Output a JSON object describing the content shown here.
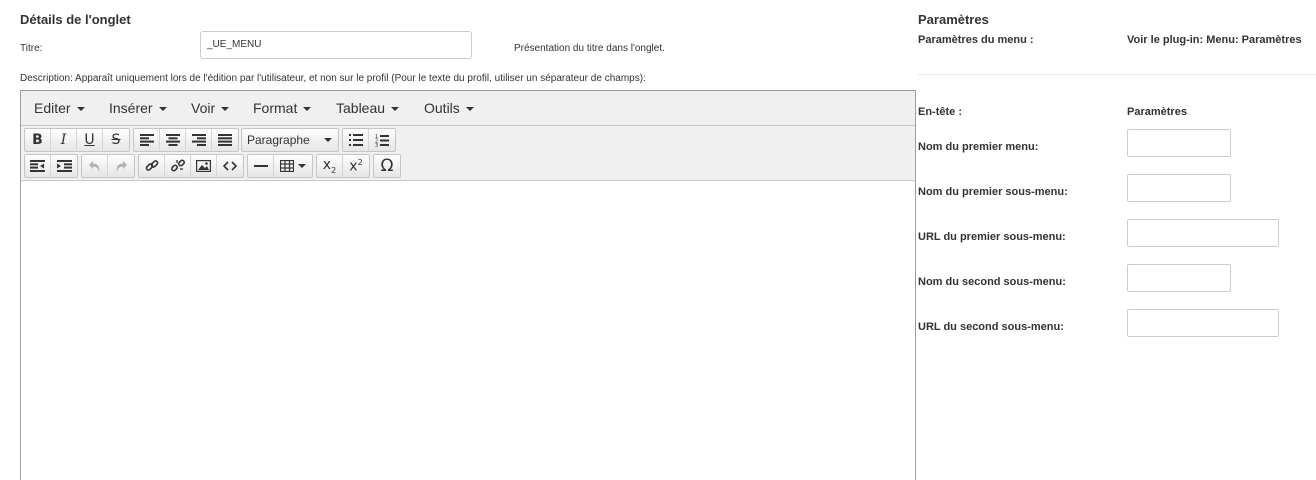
{
  "left": {
    "section_title": "Détails de l'onglet",
    "title_label": "Titre:",
    "title_value": "_UE_MENU",
    "title_hint": "Présentation du titre dans l'onglet.",
    "description_label": "Description: Apparaît uniquement lors de l'édition par l'utilisateur, et non sur le profil (Pour le texte du profil, utiliser un séparateur de champs):"
  },
  "editor": {
    "menu": [
      "Editer",
      "Insérer",
      "Voir",
      "Format",
      "Tableau",
      "Outils"
    ],
    "format_select": "Paragraphe",
    "toolbar_icons": {
      "bold": "B",
      "italic": "I",
      "underline": "U",
      "strike": "S",
      "subscript": "x",
      "superscript": "x",
      "omega": "Ω"
    },
    "content": ""
  },
  "right": {
    "title": "Paramètres",
    "menu_params_label": "Paramètres du menu :",
    "menu_params_link": "Voir le plug-in: Menu: Paramètres",
    "header_label": "En-tête :",
    "header_value": "Paramètres",
    "fields": [
      {
        "label": "Nom du premier menu:",
        "value": ""
      },
      {
        "label": "Nom du premier sous-menu:",
        "value": ""
      },
      {
        "label": "URL du premier sous-menu:",
        "value": ""
      },
      {
        "label": "Nom du second sous-menu:",
        "value": ""
      },
      {
        "label": "URL du second sous-menu:",
        "value": ""
      }
    ]
  }
}
